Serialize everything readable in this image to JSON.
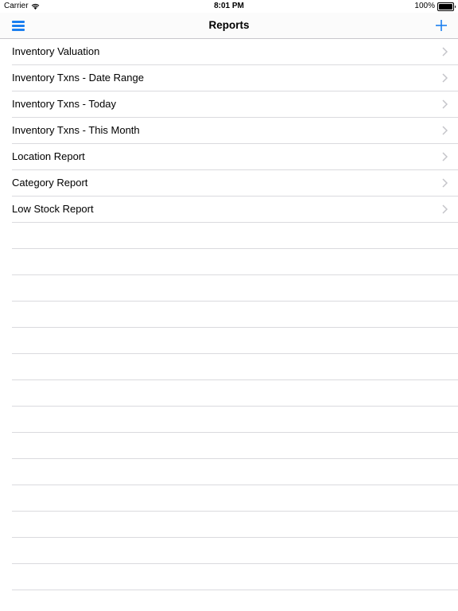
{
  "status_bar": {
    "carrier": "Carrier",
    "time": "8:01 PM",
    "battery": "100%",
    "battery_level": 1.0
  },
  "nav": {
    "title": "Reports",
    "menu_icon": "hamburger-menu-icon",
    "add_icon": "plus-icon",
    "accent_color": "#1b7ff0"
  },
  "reports": [
    {
      "label": "Inventory Valuation"
    },
    {
      "label": "Inventory Txns - Date Range"
    },
    {
      "label": "Inventory Txns - Today"
    },
    {
      "label": "Inventory Txns - This Month"
    },
    {
      "label": "Location Report"
    },
    {
      "label": "Category Report"
    },
    {
      "label": "Low Stock Report"
    }
  ]
}
